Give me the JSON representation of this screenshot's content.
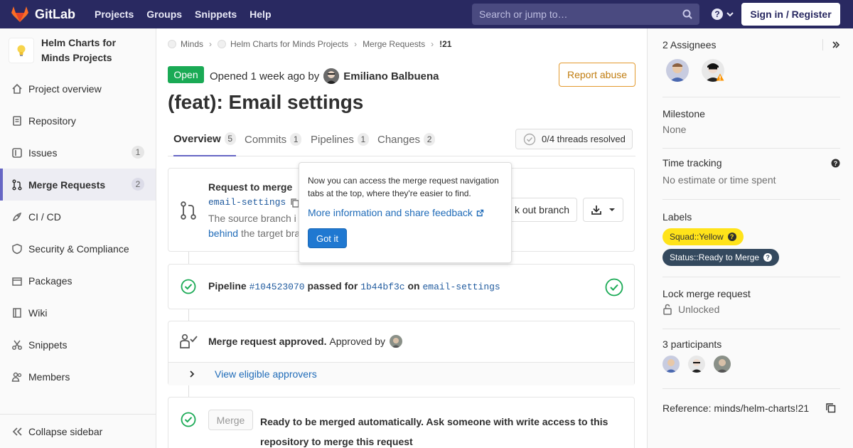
{
  "topbar": {
    "brand": "GitLab",
    "nav": [
      "Projects",
      "Groups",
      "Snippets",
      "Help"
    ],
    "search_placeholder": "Search or jump to…",
    "signin": "Sign in / Register"
  },
  "sidebar": {
    "project_name": "Helm Charts for Minds Projects",
    "items": [
      {
        "label": "Project overview",
        "icon": "home-icon"
      },
      {
        "label": "Repository",
        "icon": "doc-icon"
      },
      {
        "label": "Issues",
        "icon": "issues-icon",
        "count": "1"
      },
      {
        "label": "Merge Requests",
        "icon": "merge-icon",
        "count": "2",
        "active": true
      },
      {
        "label": "CI / CD",
        "icon": "rocket-icon"
      },
      {
        "label": "Security & Compliance",
        "icon": "shield-icon"
      },
      {
        "label": "Packages",
        "icon": "package-icon"
      },
      {
        "label": "Wiki",
        "icon": "book-icon"
      },
      {
        "label": "Snippets",
        "icon": "scissors-icon"
      },
      {
        "label": "Members",
        "icon": "users-icon"
      }
    ],
    "collapse": "Collapse sidebar"
  },
  "breadcrumb": [
    "Minds",
    "Helm Charts for Minds Projects",
    "Merge Requests",
    "!21"
  ],
  "mr": {
    "status": "Open",
    "opened_text": "Opened 1 week ago by",
    "author": "Emiliano Balbuena",
    "report": "Report abuse",
    "title": "(feat): Email settings",
    "tabs": [
      {
        "label": "Overview",
        "count": "5"
      },
      {
        "label": "Commits",
        "count": "1"
      },
      {
        "label": "Pipelines",
        "count": "1"
      },
      {
        "label": "Changes",
        "count": "2"
      }
    ],
    "threads": "0/4 threads resolved"
  },
  "widget_merge": {
    "title": "Request to merge",
    "branch": "email-settings",
    "line2_start": "The source branch i",
    "behind": "behind",
    "line3_rest": "the target bra",
    "checkout": "k out branch"
  },
  "pipeline": {
    "label": "Pipeline",
    "id": "#104523070",
    "passed_for": "passed for",
    "commit": "1b44bf3c",
    "on": "on",
    "branch": "email-settings"
  },
  "approval": {
    "approved": "Merge request approved.",
    "approved_by": "Approved by",
    "view": "View eligible approvers"
  },
  "merge_box": {
    "button": "Merge",
    "line1": "Ready to be merged automatically. Ask someone with write access to this",
    "line2": "repository to merge this request"
  },
  "popover": {
    "text": "Now you can access the merge request navigation tabs at the top, where they're easier to find.",
    "link": "More information and share feedback",
    "button": "Got it"
  },
  "right": {
    "assignees": "2 Assignees",
    "milestone_title": "Milestone",
    "milestone_value": "None",
    "time_title": "Time tracking",
    "time_value": "No estimate or time spent",
    "labels_title": "Labels",
    "label1": "Squad::Yellow",
    "label2": "Status::Ready to Merge",
    "lock_title": "Lock merge request",
    "lock_value": "Unlocked",
    "participants": "3 participants",
    "reference": "Reference: minds/helm-charts!21"
  },
  "colors": {
    "nav": "#292961",
    "open": "#1aaa55",
    "accent": "#6666c4",
    "link": "#1f6bb8",
    "success": "#1aaa55"
  }
}
